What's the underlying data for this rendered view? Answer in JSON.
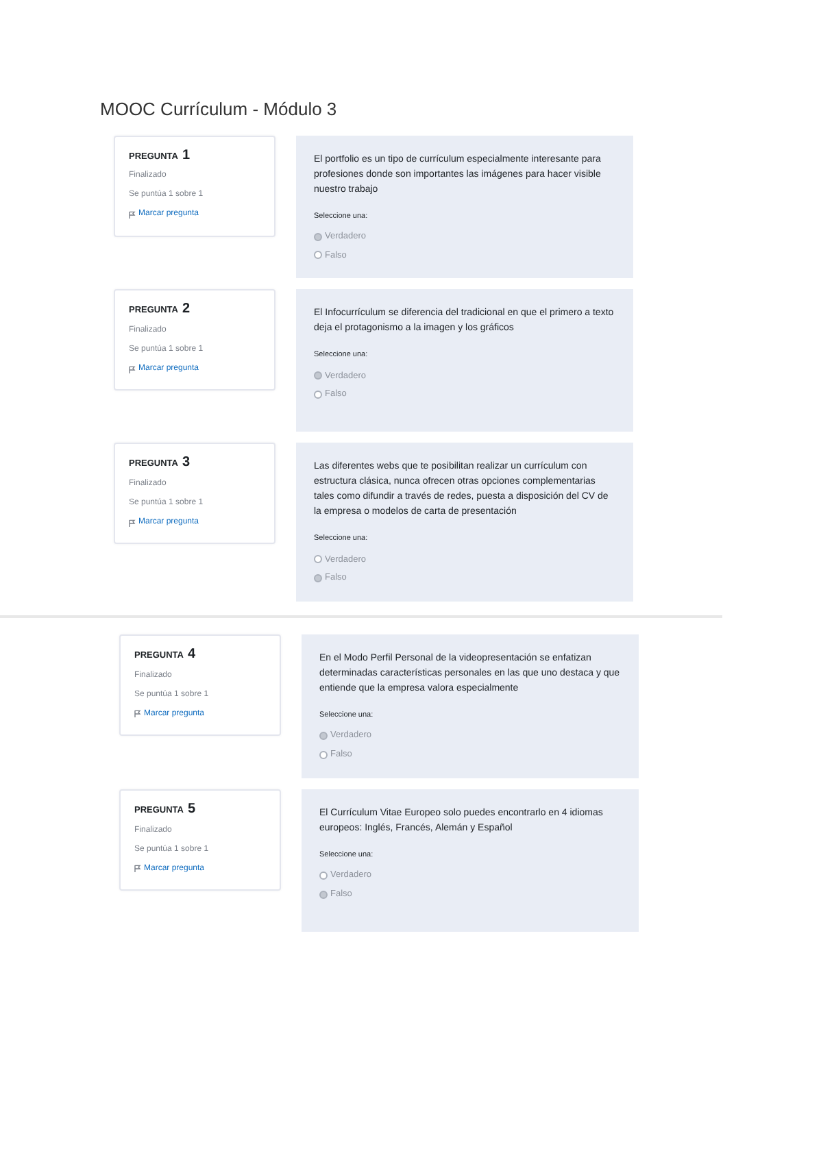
{
  "title": "MOOC Currículum - Módulo 3",
  "groups": [
    {
      "questions": [
        {
          "label": "PREGUNTA",
          "number": "1",
          "status": "Finalizado",
          "score": "Se puntúa 1 sobre 1",
          "flag": "Marcar pregunta",
          "text": "El portfolio es un tipo de currículum especialmente interesante para profesiones donde son importantes las imágenes para hacer visible nuestro trabajo",
          "prompt": "Seleccione una:",
          "options": [
            {
              "label": "Verdadero",
              "selected": true
            },
            {
              "label": "Falso",
              "selected": false
            }
          ]
        },
        {
          "label": "PREGUNTA",
          "number": "2",
          "status": "Finalizado",
          "score": "Se puntúa 1 sobre 1",
          "flag": "Marcar pregunta",
          "text": "El Infocurrículum se diferencia del tradicional en que el primero a texto deja el protagonismo a la imagen y los gráficos",
          "prompt": "Seleccione una:",
          "options": [
            {
              "label": "Verdadero",
              "selected": true
            },
            {
              "label": "Falso",
              "selected": false
            }
          ]
        },
        {
          "label": "PREGUNTA",
          "number": "3",
          "status": "Finalizado",
          "score": "Se puntúa 1 sobre 1",
          "flag": "Marcar pregunta",
          "text": "Las diferentes webs que te posibilitan realizar un currículum con estructura clásica, nunca ofrecen otras opciones complementarias tales como difundir a través de redes, puesta a disposición del CV de la empresa o modelos de carta de presentación",
          "prompt": "Seleccione una:",
          "options": [
            {
              "label": "Verdadero",
              "selected": false
            },
            {
              "label": "Falso",
              "selected": true
            }
          ]
        }
      ]
    },
    {
      "questions": [
        {
          "label": "PREGUNTA",
          "number": "4",
          "status": "Finalizado",
          "score": "Se puntúa 1 sobre 1",
          "flag": "Marcar pregunta",
          "text": "En el Modo Perfil Personal de la videopresentación se enfatizan determinadas características personales en las que uno destaca y que entiende que la empresa valora especialmente",
          "prompt": "Seleccione una:",
          "options": [
            {
              "label": "Verdadero",
              "selected": true
            },
            {
              "label": "Falso",
              "selected": false
            }
          ]
        },
        {
          "label": "PREGUNTA",
          "number": "5",
          "status": "Finalizado",
          "score": "Se puntúa 1 sobre 1",
          "flag": "Marcar pregunta",
          "text": "El Currículum Vitae Europeo solo puedes encontrarlo en 4 idiomas europeos: Inglés, Francés, Alemán y Español",
          "prompt": "Seleccione una:",
          "options": [
            {
              "label": "Verdadero",
              "selected": false
            },
            {
              "label": "Falso",
              "selected": true
            }
          ]
        }
      ]
    }
  ]
}
